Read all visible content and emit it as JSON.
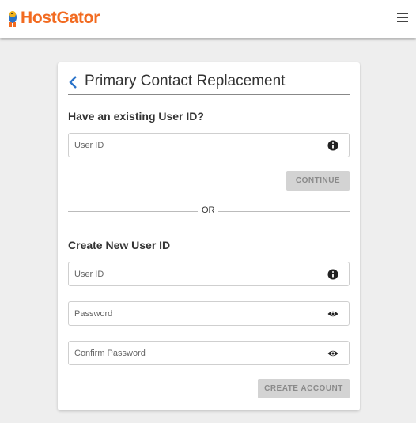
{
  "brand": {
    "name": "HostGator",
    "color": "#f26b21"
  },
  "topbar": {
    "menu_icon": "hamburger-menu-icon"
  },
  "page": {
    "title": "Primary Contact Replacement",
    "back_icon": "chevron-left-icon"
  },
  "existing": {
    "heading": "Have an existing User ID?",
    "user_id_placeholder": "User ID",
    "info_icon": "info-icon",
    "continue_label": "CONTINUE"
  },
  "divider": {
    "label": "OR"
  },
  "create": {
    "heading": "Create New User ID",
    "user_id_placeholder": "User ID",
    "password_placeholder": "Password",
    "confirm_placeholder": "Confirm Password",
    "eye_icon": "eye-icon",
    "create_label": "CREATE ACCOUNT"
  },
  "colors": {
    "accent": "#2a73c9",
    "button_disabled": "#d3d3d3"
  }
}
